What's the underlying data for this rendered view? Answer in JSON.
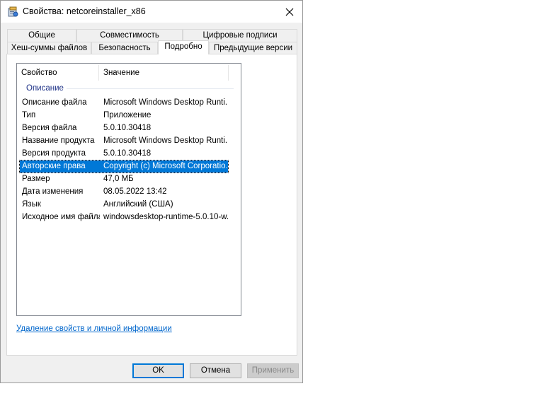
{
  "window": {
    "title": "Свойства: netcoreinstaller_x86"
  },
  "tabs": {
    "row1": [
      "Общие",
      "Совместимость",
      "Цифровые подписи"
    ],
    "row2": [
      "Хеш-суммы файлов",
      "Безопасность",
      "Подробно",
      "Предыдущие версии"
    ],
    "active": "Подробно"
  },
  "details": {
    "columns": [
      "Свойство",
      "Значение"
    ],
    "group": "Описание",
    "rows": [
      {
        "property": "Описание файла",
        "value": "Microsoft Windows Desktop Runti..."
      },
      {
        "property": "Тип",
        "value": "Приложение"
      },
      {
        "property": "Версия файла",
        "value": "5.0.10.30418"
      },
      {
        "property": "Название продукта",
        "value": "Microsoft Windows Desktop Runti..."
      },
      {
        "property": "Версия продукта",
        "value": "5.0.10.30418"
      },
      {
        "property": "Авторские права",
        "value": "Copyright (c) Microsoft Corporatio..."
      },
      {
        "property": "Размер",
        "value": "47,0 МБ"
      },
      {
        "property": "Дата изменения",
        "value": "08.05.2022 13:42"
      },
      {
        "property": "Язык",
        "value": "Английский (США)"
      },
      {
        "property": "Исходное имя файла",
        "value": "windowsdesktop-runtime-5.0.10-w..."
      }
    ],
    "selected_row": "Авторские права"
  },
  "link": {
    "text": "Удаление свойств и личной информации"
  },
  "buttons": {
    "ok": "OK",
    "cancel": "Отмена",
    "apply": "Применить"
  },
  "colors": {
    "selection": "#0078d7",
    "link": "#0066cc",
    "group_header": "#1e3287"
  }
}
